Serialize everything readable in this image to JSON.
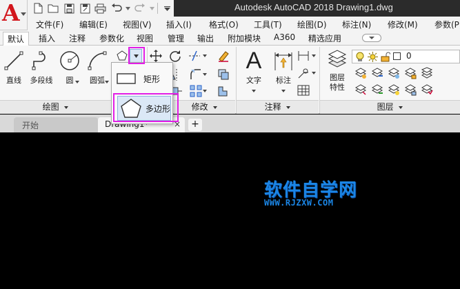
{
  "app": {
    "logo_letter": "A",
    "title": "Autodesk AutoCAD 2018    Drawing1.dwg"
  },
  "menu": {
    "items": [
      "文件(F)",
      "编辑(E)",
      "视图(V)",
      "插入(I)",
      "格式(O)",
      "工具(T)",
      "绘图(D)",
      "标注(N)",
      "修改(M)",
      "参数(P)"
    ]
  },
  "ribbon_tabs": {
    "items": [
      "默认",
      "插入",
      "注释",
      "参数化",
      "视图",
      "管理",
      "输出",
      "附加模块",
      "A360",
      "精选应用"
    ],
    "active": "默认"
  },
  "draw_panel": {
    "title": "绘图",
    "line": "直线",
    "polyline": "多段线",
    "circle": "圆",
    "arc": "圆弧"
  },
  "modify_panel": {
    "title": "修改"
  },
  "annotation_panel": {
    "title": "注释",
    "text": "文字",
    "dimension": "标注"
  },
  "layers_panel": {
    "title": "图层",
    "layer_properties_line1": "图层",
    "layer_properties_line2": "特性",
    "current_layer": "0"
  },
  "flyout": {
    "rectangle": "矩形",
    "polygon": "多边形"
  },
  "file_tabs": {
    "start": "开始",
    "drawing": "Drawing1*",
    "close": "×",
    "add": "+"
  },
  "watermark": {
    "title": "软件自学网",
    "url": "WWW.RJZXW.COM"
  },
  "colors": {
    "highlight": "#e21ee6",
    "watermark": "#1b86e6",
    "logo": "#d2161c",
    "canvas": "#000000"
  }
}
